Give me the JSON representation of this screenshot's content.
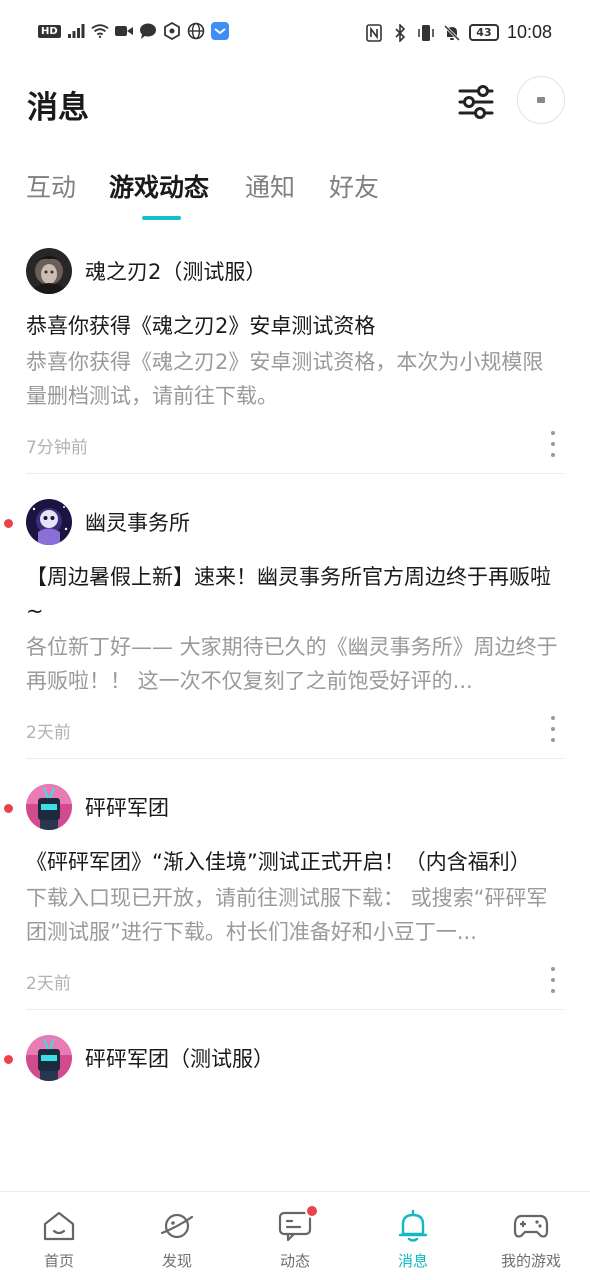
{
  "status_bar": {
    "left_badge": "HD",
    "network": "5G",
    "battery_level": "43",
    "time": "10:08"
  },
  "header": {
    "title": "消息"
  },
  "tabs": [
    {
      "label": "互动",
      "active": false
    },
    {
      "label": "游戏动态",
      "active": true
    },
    {
      "label": "通知",
      "active": false
    },
    {
      "label": "好友",
      "active": false
    }
  ],
  "messages": [
    {
      "game": "魂之刃2（测试服）",
      "unread": false,
      "title": "恭喜你获得《魂之刃2》安卓测试资格",
      "body": "恭喜你获得《魂之刃2》安卓测试资格，本次为小规模限量删档测试，请前往下载。",
      "time": "7分钟前"
    },
    {
      "game": "幽灵事务所",
      "unread": true,
      "title": "【周边暑假上新】速来！幽灵事务所官方周边终于再贩啦~",
      "body": "各位新丁好—— 大家期待已久的《幽灵事务所》周边终于再贩啦！！ 这一次不仅复刻了之前饱受好评的...",
      "time": "2天前"
    },
    {
      "game": "砰砰军团",
      "unread": true,
      "title": "《砰砰军团》“渐入佳境”测试正式开启！（内含福利）",
      "body": "下载入口现已开放，请前往测试服下载： 或搜索“砰砰军团测试服”进行下载。村长们准备好和小豆丁一...",
      "time": "2天前"
    },
    {
      "game": "砰砰军团（测试服）",
      "unread": true
    }
  ],
  "bottom_nav": [
    {
      "label": "首页",
      "icon": "home-icon",
      "active": false
    },
    {
      "label": "发现",
      "icon": "planet-icon",
      "active": false
    },
    {
      "label": "动态",
      "icon": "chat-icon",
      "active": false,
      "badge": true
    },
    {
      "label": "消息",
      "icon": "bell-icon",
      "active": true
    },
    {
      "label": "我的游戏",
      "icon": "gamepad-icon",
      "active": false
    }
  ],
  "colors": {
    "accent": "#14c1c8",
    "unread": "#e8434a",
    "muted_text": "#9a9a9a"
  }
}
